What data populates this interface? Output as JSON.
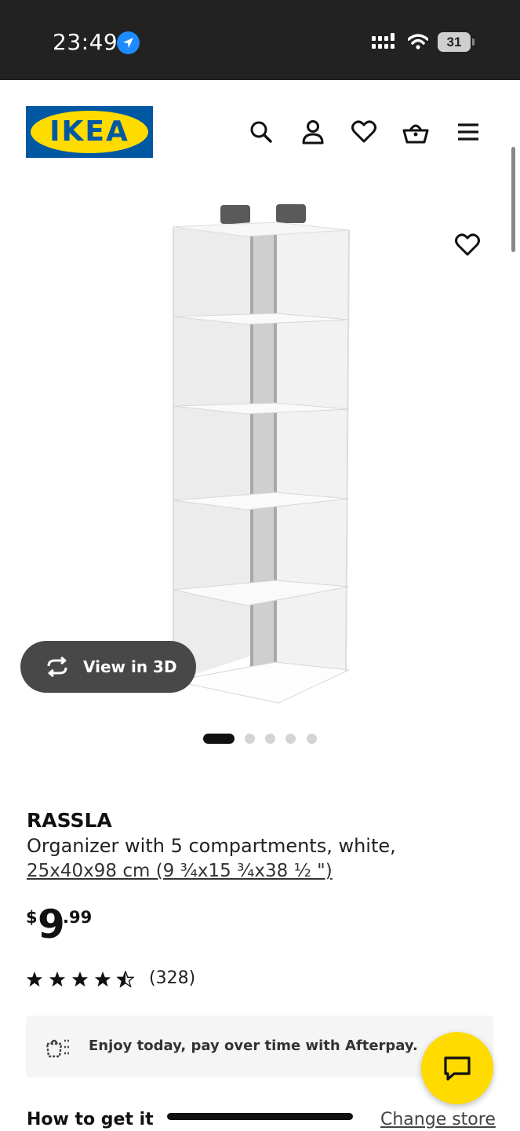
{
  "status_bar": {
    "time": "23:49",
    "battery": "31",
    "icons": [
      "location-arrow-icon",
      "signal-icon",
      "wifi-icon",
      "battery-icon"
    ]
  },
  "header": {
    "logo_text": "IKEA",
    "icons": [
      "search-icon",
      "account-icon",
      "wishlist-icon",
      "basket-icon",
      "menu-icon"
    ]
  },
  "gallery": {
    "view3d_label": "View in 3D",
    "slide_count": 5,
    "active_slide": 1
  },
  "product": {
    "name": "RASSLA",
    "description": "Organizer with 5 compartments, white,",
    "dimensions": "25x40x98 cm (9 ¾x15 ¾x38 ½ \")",
    "price": {
      "currency": "$",
      "integer": "9",
      "decimal": ".99"
    },
    "rating": {
      "stars": 4.5,
      "max": 5,
      "count_text": "(328)"
    }
  },
  "afterpay": {
    "text": "Enjoy today, pay over time with Afterpay."
  },
  "fulfillment": {
    "title": "How to get it",
    "change_store": "Change store"
  },
  "colors": {
    "ikea_blue": "#0058a3",
    "ikea_yellow": "#ffdb00",
    "status_bar": "#222222",
    "dark_button": "#484848"
  }
}
